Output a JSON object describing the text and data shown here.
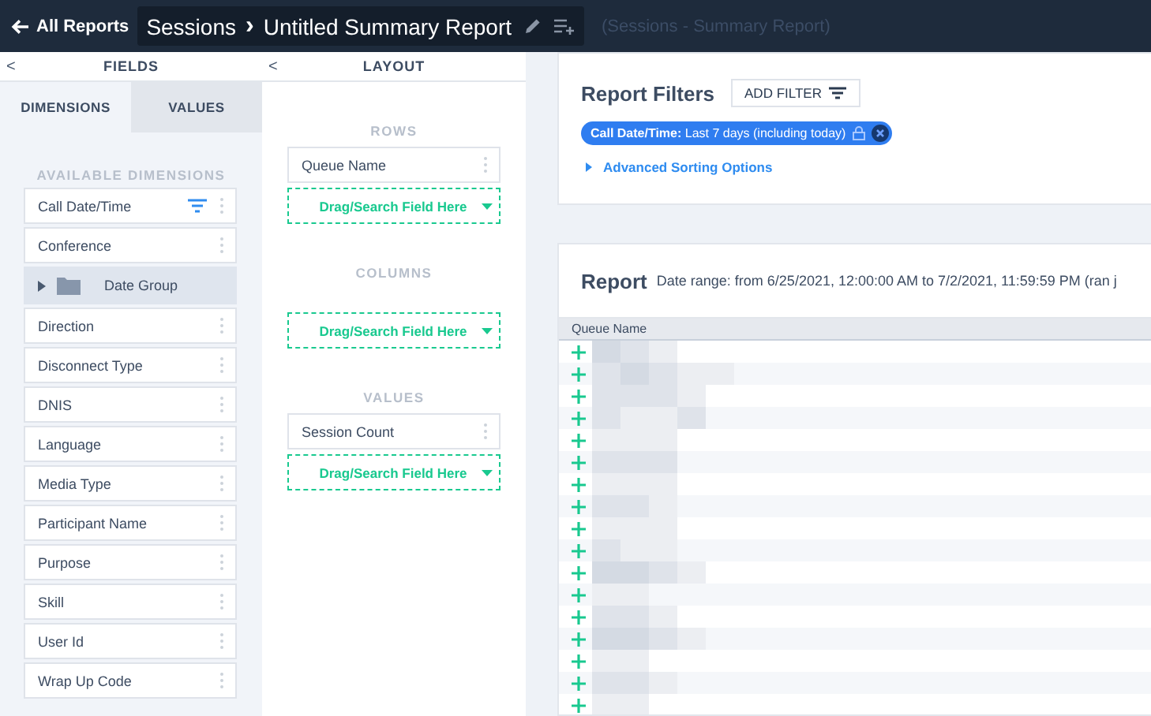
{
  "topbar": {
    "back": "All Reports",
    "source": "Sessions",
    "separator": "›",
    "title": "Untitled Summary Report",
    "subtitle": "(Sessions - Summary Report)"
  },
  "fields_panel": {
    "title": "FIELDS",
    "collapse": "<",
    "tabs": [
      {
        "label": "DIMENSIONS",
        "selected": true
      },
      {
        "label": "VALUES",
        "selected": false
      }
    ],
    "section": "AVAILABLE DIMENSIONS",
    "items": [
      {
        "label": "Call Date/Time",
        "kind": "field",
        "filtered": true
      },
      {
        "label": "Conference",
        "kind": "field",
        "filtered": false
      },
      {
        "label": "Date Group",
        "kind": "folder",
        "filtered": false
      },
      {
        "label": "Direction",
        "kind": "field",
        "filtered": false
      },
      {
        "label": "Disconnect Type",
        "kind": "field",
        "filtered": false
      },
      {
        "label": "DNIS",
        "kind": "field",
        "filtered": false
      },
      {
        "label": "Language",
        "kind": "field",
        "filtered": false
      },
      {
        "label": "Media Type",
        "kind": "field",
        "filtered": false
      },
      {
        "label": "Participant Name",
        "kind": "field",
        "filtered": false
      },
      {
        "label": "Purpose",
        "kind": "field",
        "filtered": false
      },
      {
        "label": "Skill",
        "kind": "field",
        "filtered": false
      },
      {
        "label": "User Id",
        "kind": "field",
        "filtered": false
      },
      {
        "label": "Wrap Up Code",
        "kind": "field",
        "filtered": false
      }
    ]
  },
  "layout_panel": {
    "title": "LAYOUT",
    "collapse": "<",
    "sections": [
      {
        "label": "ROWS",
        "fields": [
          "Queue Name"
        ],
        "drop": "Drag/Search Field Here"
      },
      {
        "label": "COLUMNS",
        "drop": "Drag/Search Field Here"
      },
      {
        "label": "VALUES",
        "fields": [
          "Session Count"
        ],
        "drop": "Drag/Search Field Here"
      }
    ]
  },
  "filters": {
    "title": "Report Filters",
    "add_button": "ADD FILTER",
    "chips": [
      "**Call Date/Time:** Last 7 days (including today)"
    ],
    "sorting_link": "Advanced Sorting Options"
  },
  "report": {
    "title": "Report",
    "date_range": "Date range: from 6/25/2021, 12:00:00 AM to 7/2/2021, 11:59:59 PM (ran j",
    "columns": [
      "Queue Name"
    ],
    "rows": [
      {
        "expanded": false
      },
      {
        "expanded": false
      },
      {
        "expanded": false
      },
      {
        "expanded": false
      },
      {
        "expanded": false
      },
      {
        "expanded": false
      },
      {
        "expanded": false
      },
      {
        "expanded": false
      },
      {
        "expanded": false
      },
      {
        "expanded": false
      },
      {
        "expanded": false
      },
      {
        "expanded": false
      },
      {
        "expanded": false
      },
      {
        "expanded": false
      },
      {
        "expanded": false
      },
      {
        "expanded": false
      },
      {
        "expanded": false
      }
    ]
  }
}
